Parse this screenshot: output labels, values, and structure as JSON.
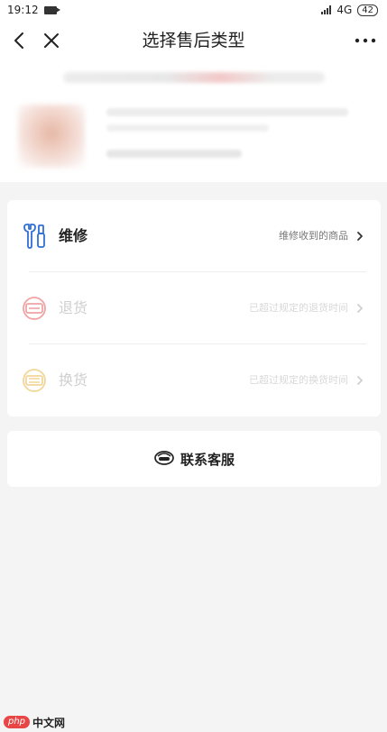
{
  "status_bar": {
    "time": "19:12",
    "network": "4G",
    "battery": "42"
  },
  "nav": {
    "title": "选择售后类型",
    "back_icon": "chevron-left-icon",
    "close_icon": "close-icon",
    "more_icon": "more-icon"
  },
  "options": [
    {
      "label": "维修",
      "description": "维修收到的商品",
      "icon": "repair-icon",
      "enabled": true
    },
    {
      "label": "退货",
      "description": "已超过规定的退货时间",
      "icon": "return-icon",
      "enabled": false
    },
    {
      "label": "换货",
      "description": "已超过规定的换货时间",
      "icon": "exchange-icon",
      "enabled": false
    }
  ],
  "contact": {
    "label": "联系客服",
    "icon": "customer-service-icon"
  },
  "watermark": {
    "logo": "php",
    "text": "中文网"
  },
  "colors": {
    "page_bg": "#f4f4f4",
    "card_bg": "#ffffff",
    "repair_icon": "#2f6fd6",
    "return_icon": "#f0a3a3",
    "exchange_icon": "#f2d69a",
    "watermark_red": "#e84545"
  }
}
